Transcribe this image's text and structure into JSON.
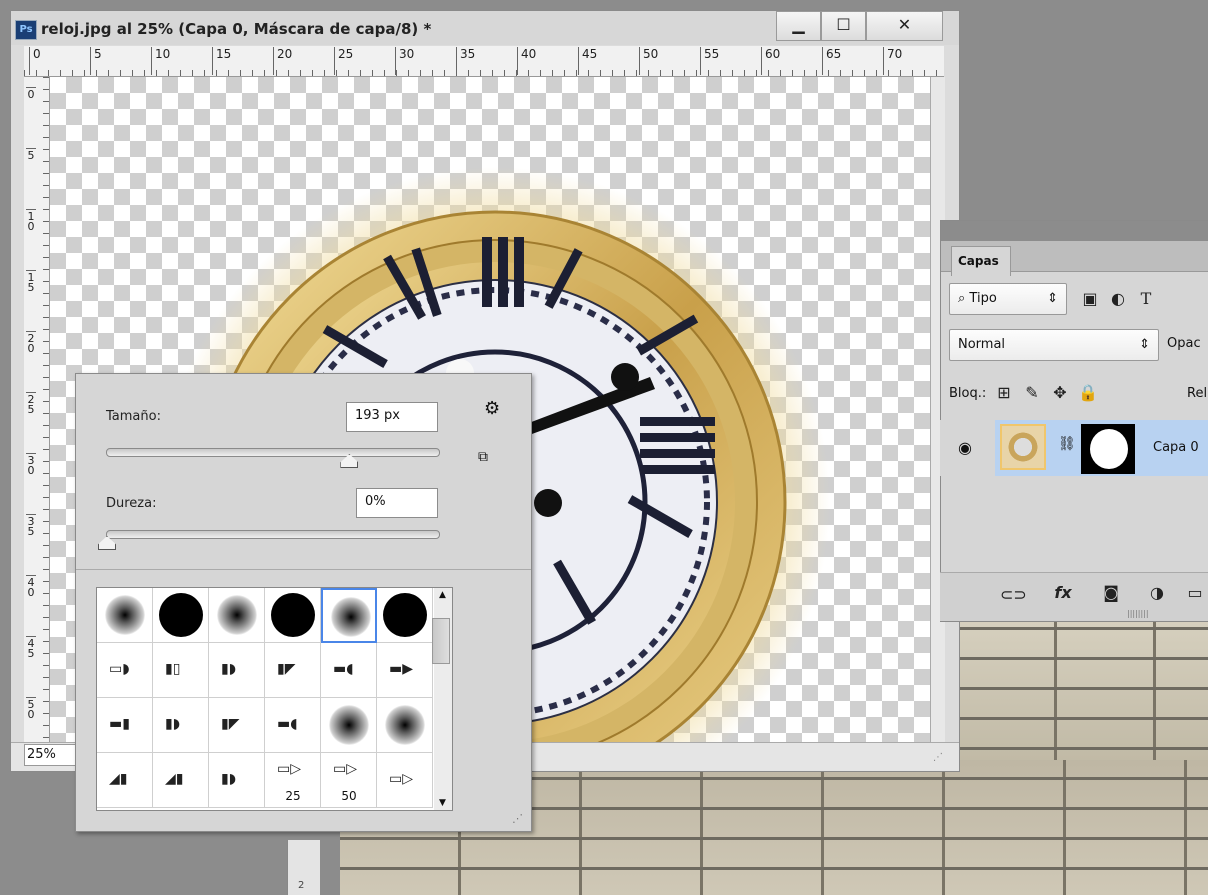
{
  "document": {
    "app_icon": "Ps",
    "title": "reloj.jpg al 25% (Capa 0, Máscara de capa/8) *",
    "window_buttons": {
      "minimize": "▁",
      "maximize": "☐",
      "close": "✕"
    },
    "zoom": "25%",
    "ruler_h": [
      "0",
      "5",
      "10",
      "15",
      "20",
      "25",
      "30",
      "35",
      "40",
      "45",
      "50",
      "55",
      "60",
      "65",
      "70"
    ],
    "ruler_v": [
      {
        "a": "0",
        "b": ""
      },
      {
        "a": "5",
        "b": ""
      },
      {
        "a": "1",
        "b": "0"
      },
      {
        "a": "1",
        "b": "5"
      },
      {
        "a": "2",
        "b": "0"
      },
      {
        "a": "2",
        "b": "5"
      },
      {
        "a": "3",
        "b": "0"
      },
      {
        "a": "3",
        "b": "5"
      },
      {
        "a": "4",
        "b": "0"
      },
      {
        "a": "4",
        "b": "5"
      },
      {
        "a": "5",
        "b": "0"
      }
    ],
    "bottom_ruler_digit": "2"
  },
  "brush_panel": {
    "size_label": "Tamaño:",
    "size_value": "193 px",
    "size_fraction": 0.73,
    "hardness_label": "Dureza:",
    "hardness_value": "0%",
    "hardness_fraction": 0.0,
    "settings_icon": "gear-icon",
    "new_preset_icon": "new-preset-icon",
    "presets": [
      {
        "kind": "soft"
      },
      {
        "kind": "hard"
      },
      {
        "kind": "soft"
      },
      {
        "kind": "hard"
      },
      {
        "kind": "soft",
        "selected": true
      },
      {
        "kind": "hard"
      },
      {
        "kind": "tip",
        "shape": "chisel-round"
      },
      {
        "kind": "tip",
        "shape": "flat"
      },
      {
        "kind": "tip",
        "shape": "round-end"
      },
      {
        "kind": "tip",
        "shape": "angled"
      },
      {
        "kind": "tip",
        "shape": "fan"
      },
      {
        "kind": "tip",
        "shape": "pointed"
      },
      {
        "kind": "tip",
        "shape": "block"
      },
      {
        "kind": "tip",
        "shape": "round-end"
      },
      {
        "kind": "tip",
        "shape": "angled"
      },
      {
        "kind": "tip",
        "shape": "fan"
      },
      {
        "kind": "soft"
      },
      {
        "kind": "soft"
      },
      {
        "kind": "tip",
        "shape": "slant"
      },
      {
        "kind": "tip",
        "shape": "slant"
      },
      {
        "kind": "tip",
        "shape": "round-end"
      },
      {
        "kind": "tip",
        "shape": "pen",
        "label": "25"
      },
      {
        "kind": "tip",
        "shape": "pen",
        "label": "50"
      },
      {
        "kind": "tip",
        "shape": "pen"
      }
    ]
  },
  "layers_panel": {
    "tab": "Capas",
    "filter_type": "Tipo",
    "blend_mode": "Normal",
    "opacity_label": "Opac",
    "lock_label": "Bloq.:",
    "fill_label": "Rel",
    "layer_name": "Capa 0",
    "footer_icons": [
      "link-icon",
      "fx-icon",
      "mask-icon",
      "adjustment-icon",
      "new-group-icon"
    ],
    "fx_text": "fx"
  }
}
